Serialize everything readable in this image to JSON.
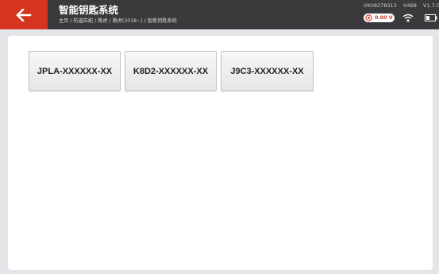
{
  "header": {
    "title": "智能钥匙系统",
    "breadcrumb": "主页 / 防盗匹配 / 路虎 / 路虎(2018~) / 智能钥匙系统",
    "serial": "VK08278313",
    "model": "V468",
    "version": "V1.7.0",
    "voltage": "0.00 V"
  },
  "main": {
    "options": [
      {
        "label": "JPLA-XXXXXX-XX"
      },
      {
        "label": "K8D2-XXXXXX-XX"
      },
      {
        "label": "J9C3-XXXXXX-XX"
      }
    ]
  },
  "icons": {
    "back": "arrow-left-icon",
    "voltage": "voltage-gauge-icon",
    "wifi": "wifi-icon",
    "battery": "battery-icon"
  },
  "colors": {
    "accent": "#d6341f",
    "header_bg": "#3a3a3c",
    "page_bg": "#e4e5e9"
  }
}
